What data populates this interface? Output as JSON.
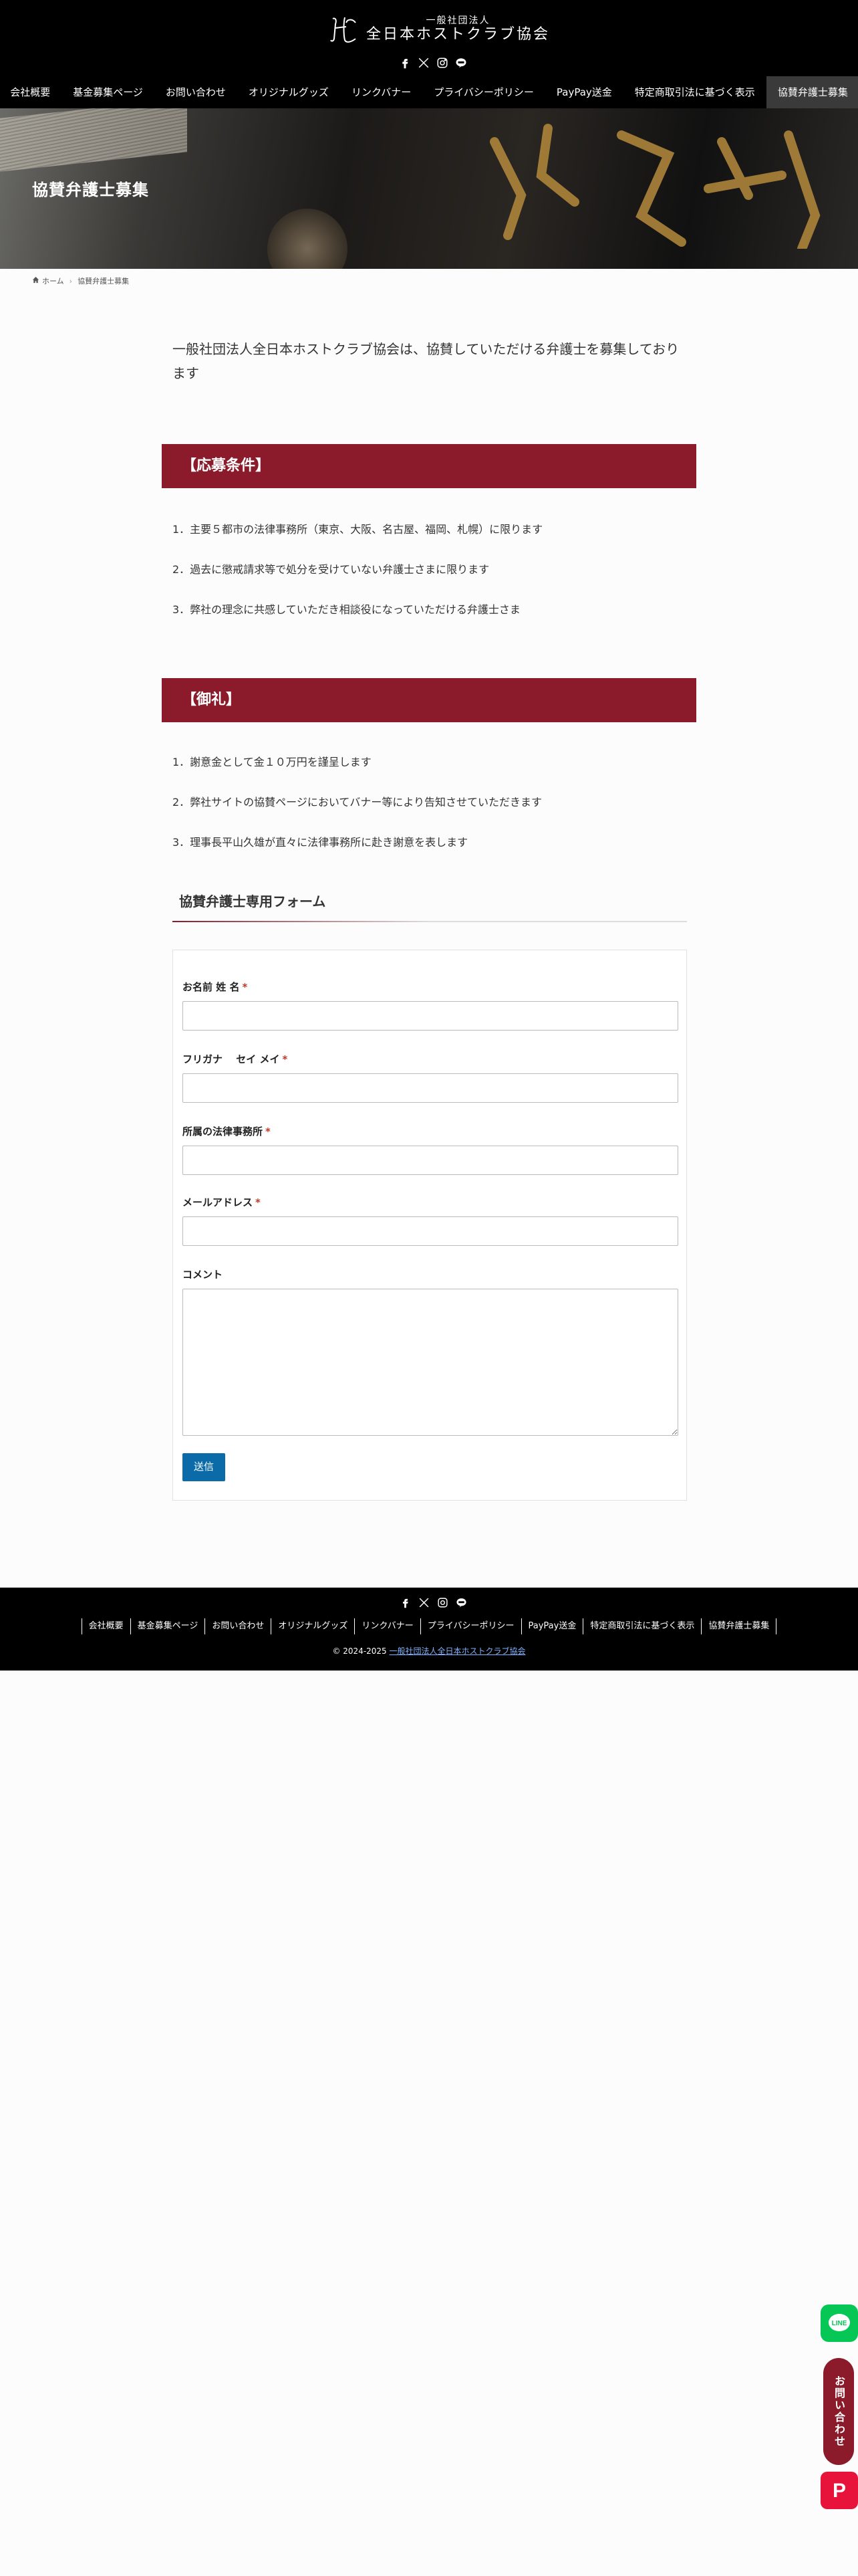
{
  "header": {
    "logo_small": "一般社団法人",
    "logo_big": "全日本ホストクラブ協会",
    "sns": [
      "facebook-icon",
      "x-icon",
      "instagram-icon",
      "line-icon"
    ],
    "nav": [
      {
        "label": "会社概要"
      },
      {
        "label": "基金募集ページ"
      },
      {
        "label": "お問い合わせ"
      },
      {
        "label": "オリジナルグッズ"
      },
      {
        "label": "リンクバナー"
      },
      {
        "label": "プライバシーポリシー"
      },
      {
        "label": "PayPay送金"
      },
      {
        "label": "特定商取引法に基づく表示"
      },
      {
        "label": "協賛弁護士募集",
        "active": true
      }
    ]
  },
  "hero": {
    "title": "協賛弁護士募集"
  },
  "breadcrumb": {
    "home": "ホーム",
    "current": "協賛弁護士募集"
  },
  "lead": "一般社団法人全日本ホストクラブ協会は、協賛していただける弁護士を募集しております",
  "sections": [
    {
      "heading": "【応募条件】",
      "items": [
        "1．主要５都市の法律事務所（東京、大阪、名古屋、福岡、札幌）に限ります",
        "2．過去に懲戒請求等で処分を受けていない弁護士さまに限ります",
        "3．弊社の理念に共感していただき相談役になっていただける弁護士さま"
      ]
    },
    {
      "heading": "【御礼】",
      "items": [
        "1．謝意金として金１０万円を謹呈します",
        "2．弊社サイトの協賛ページにおいてバナー等により告知させていただきます",
        "3．理事長平山久雄が直々に法律事務所に赴き謝意を表します"
      ]
    }
  ],
  "form": {
    "title": "協賛弁護士専用フォーム",
    "fields": [
      {
        "label": "お名前 姓 名",
        "required": "*",
        "value": ""
      },
      {
        "label": "フリガナ　 セイ メイ",
        "required": "*",
        "value": ""
      },
      {
        "label": "所属の法律事務所",
        "required": "*",
        "value": ""
      },
      {
        "label": "メールアドレス",
        "required": "*",
        "value": ""
      }
    ],
    "comment_label": "コメント",
    "submit": "送信"
  },
  "footer": {
    "nav": [
      "会社概要",
      "基金募集ページ",
      "お問い合わせ",
      "オリジナルグッズ",
      "リンクバナー",
      "プライバシーポリシー",
      "PayPay送金",
      "特定商取引法に基づく表示",
      "協賛弁護士募集"
    ],
    "copyright_prefix": "© 2024-2025 ",
    "copyright_link": "一般社団法人全日本ホストクラブ協会"
  },
  "floating": {
    "line_label": "LINE",
    "contact_label": "お問い合わせ",
    "paypay_label": "P"
  },
  "colors": {
    "accent": "#8b1a2b",
    "submit": "#0b6aa8",
    "header_bg": "#000000"
  }
}
